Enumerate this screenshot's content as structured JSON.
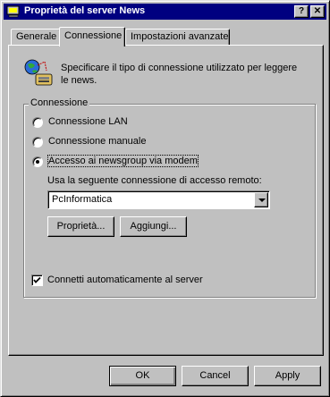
{
  "window": {
    "title": "Proprietà del server News",
    "icon": "news-server-icon",
    "help_button": "?",
    "close_button": "✕"
  },
  "tabs": [
    {
      "label": "Generale",
      "active": false
    },
    {
      "label": "Connessione",
      "active": true
    },
    {
      "label": "Impostazioni avanzate",
      "active": false
    }
  ],
  "description": {
    "icon": "network-connection-icon",
    "text": "Specificare il tipo di connessione utilizzato per leggere le news."
  },
  "connection_group": {
    "label": "Connessione",
    "options": [
      {
        "label": "Connessione LAN",
        "selected": false
      },
      {
        "label": "Connessione manuale",
        "selected": false
      },
      {
        "label": "Accesso ai newsgroup via modem",
        "selected": true
      }
    ],
    "dialup_label": "Usa la seguente connessione di accesso remoto:",
    "dialup_value": "PcInformatica",
    "properties_button": "Proprietà...",
    "add_button": "Aggiungi..."
  },
  "auto_connect": {
    "label": "Connetti automaticamente al server",
    "checked": true
  },
  "footer": {
    "ok": "OK",
    "cancel": "Cancel",
    "apply": "Apply"
  },
  "colors": {
    "face": "#c0c0c0",
    "titlebar": "#000080"
  }
}
